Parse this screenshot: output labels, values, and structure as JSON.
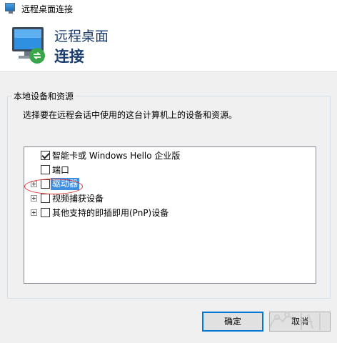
{
  "window": {
    "title": "远程桌面连接",
    "icon": "remote-desktop-icon"
  },
  "banner": {
    "line1": "远程桌面",
    "line2": "连接",
    "icon": "remote-desktop-monitor-icon"
  },
  "group": {
    "label": "本地设备和资源",
    "description": "选择要在远程会话中使用的这台计算机上的设备和资源。"
  },
  "tree": {
    "items": [
      {
        "label": "智能卡或 Windows Hello 企业版",
        "checked": true,
        "expandable": false,
        "selected": false
      },
      {
        "label": "端口",
        "checked": false,
        "expandable": false,
        "selected": false
      },
      {
        "label": "驱动器",
        "checked": false,
        "expandable": true,
        "selected": true
      },
      {
        "label": "视频捕获设备",
        "checked": false,
        "expandable": true,
        "selected": false
      },
      {
        "label": "其他支持的即插即用(PnP)设备",
        "checked": false,
        "expandable": true,
        "selected": false
      }
    ]
  },
  "buttons": {
    "ok": "确定",
    "cancel": "取消"
  },
  "colors": {
    "selection": "#3f8ee0",
    "annotation": "#e03030",
    "banner_text": "#1a3d6d",
    "default_button_border": "#0078d7"
  }
}
